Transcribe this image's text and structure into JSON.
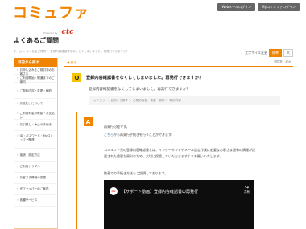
{
  "header": {
    "logo_main": "コミュファ",
    "logo_powered": "Powered by",
    "logo_brand": "ctc",
    "buttons": [
      "Webメールログイン",
      "Myコミュファログイン"
    ]
  },
  "page_title": "よくあるご質問",
  "breadcrumb": "ホーム > よくあるご質問 > 登録内容確認書をなくしてしまいました。再発行できますか？",
  "font_size": {
    "label": "文字サイズ変更",
    "options": [
      "標準",
      "大"
    ],
    "active": "標準"
  },
  "sidebar": {
    "heading": "目的から探す",
    "items": [
      "お申し込みをご検討中のお客さま",
      "ご利用開始・開通までのご案内",
      "ご契約内容・変更・解約",
      "お支払いについて",
      "ご利用料金の確認・お支払い",
      "お引越し・休止の手続き",
      "ID・パスワード・Myコミュファ関連",
      "接続・設定方法",
      "ご利用トラブル",
      "お客さま情報の変更",
      "光ファイバーのご案内",
      "各種サービス"
    ]
  },
  "main": {
    "back_label": "◀ 戻る",
    "views": "閲覧数：436",
    "q_badge": "Q",
    "question_title": "登録内容確認書をなくしてしまいました。再発行できますか？",
    "question_text": "登録内容確認書をなくしてしまいました。再発行できますか？",
    "category": "カテゴリー：目的から探す ＞ ご契約内容・変更・解約 ＞ 契約内容",
    "a_badge": "A",
    "answer_line1": "再発行可能です。",
    "answer_link": "こちら",
    "answer_line2_rest": "から再発行手続きを行うことができます。",
    "answer_para2a": "コミュファ光の登録内容確認書とは、インターネットやメール設定作業に必要なお客さま固有の情報が記",
    "answer_para2b": "載された重要な資料のため、大切に保管していただきますようお願いいたします。",
    "answer_para3": "動画での手続き方法もご説明しております。",
    "video": {
      "avatar_text": "ctc",
      "title": "【サポート動画】登録内容確認書の再発行",
      "share_label": "共有"
    }
  }
}
